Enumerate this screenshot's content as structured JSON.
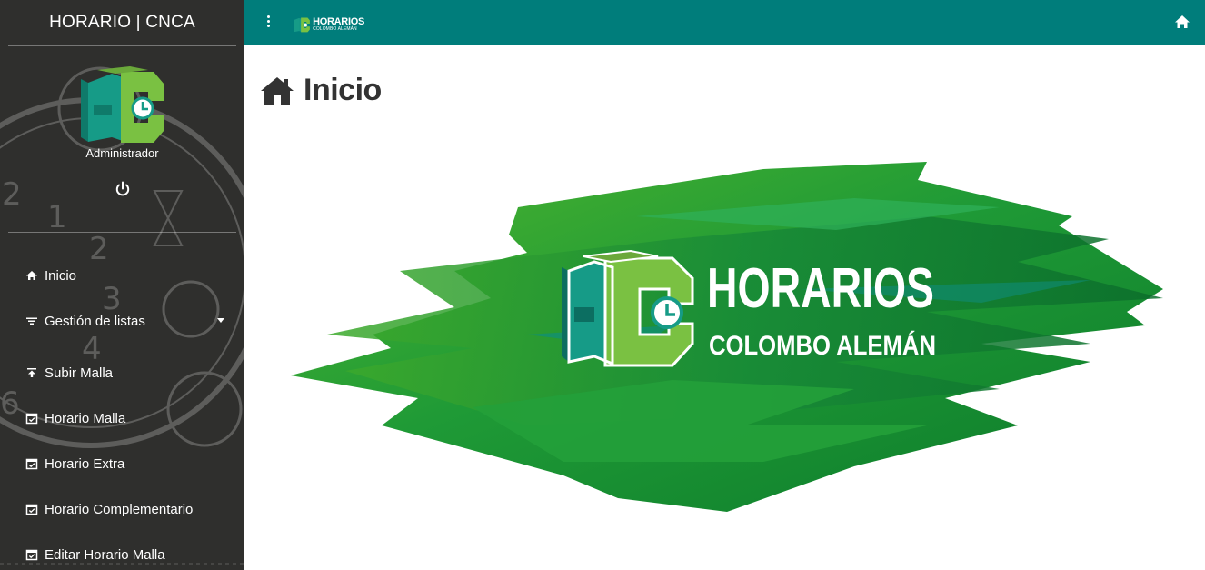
{
  "sidebar": {
    "title": "HORARIO | CNCA",
    "user_role": "Administrador",
    "menu": [
      {
        "label": "Inicio",
        "icon": "home-icon"
      },
      {
        "label": "Gestión de listas",
        "icon": "filter-list-icon"
      },
      {
        "label": "Subir Malla",
        "icon": "upload-icon"
      },
      {
        "label": "Horario Malla",
        "icon": "calendar-check-icon"
      },
      {
        "label": "Horario Extra",
        "icon": "calendar-check-icon"
      },
      {
        "label": "Horario Complementario",
        "icon": "calendar-check-icon"
      },
      {
        "label": "Editar Horario Malla",
        "icon": "calendar-check-icon"
      }
    ]
  },
  "topbar": {
    "brand_line1": "HORARIOS",
    "brand_line2": "COLOMBO ALEMÁN"
  },
  "main": {
    "page_title": "Inicio",
    "banner_line1": "HORARIOS",
    "banner_line2": "COLOMBO ALEMÁN"
  },
  "colors": {
    "topbar": "#007d7b",
    "sidebar": "#2f2f2d",
    "logo_teal": "#169b87",
    "logo_green": "#7ac142",
    "banner_green": "#1f9a36"
  }
}
